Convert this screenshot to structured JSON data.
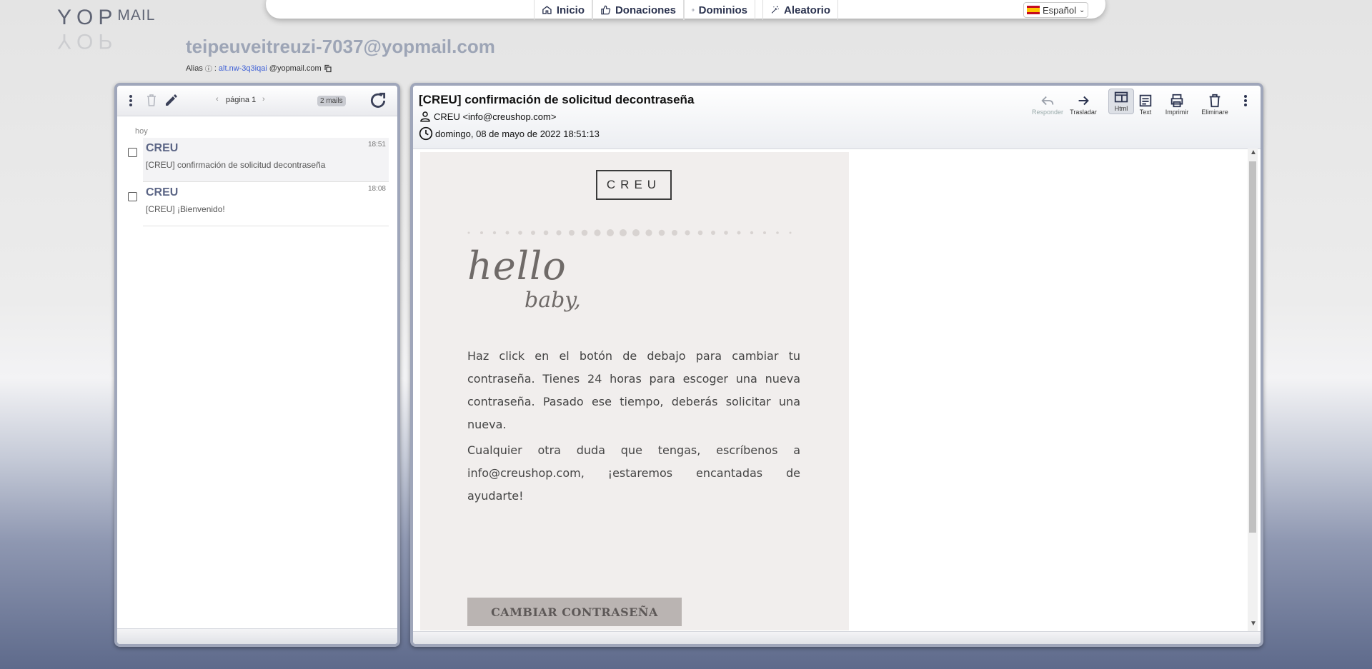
{
  "logo": {
    "text_main": "YOP",
    "text_mail": "MAIL"
  },
  "nav": {
    "items": [
      {
        "label": "Inicio",
        "icon": "home-icon"
      },
      {
        "label": "Donaciones",
        "icon": "thumbs-up-icon"
      },
      {
        "label": "Dominios",
        "icon": "globe-icon"
      },
      {
        "label": "Aleatorio",
        "icon": "magic-wand-icon"
      }
    ],
    "language": "Español"
  },
  "inbox": {
    "address": "teipeuveitreuzi-7037@yopmail.com",
    "alias_label": "Alias",
    "alias_local": "alt.nw-3q3iqai",
    "alias_domain": "@yopmail.com"
  },
  "list_toolbar": {
    "page_label": "página 1",
    "mail_count": "2 mails"
  },
  "list": {
    "day_label": "hoy",
    "mails": [
      {
        "from": "CREU",
        "subject": "[CREU] confirmación de solicitud decontraseña",
        "time": "18:51"
      },
      {
        "from": "CREU",
        "subject": "[CREU] ¡Bienvenido!",
        "time": "18:08"
      }
    ]
  },
  "message": {
    "subject": "[CREU] confirmación de solicitud decontraseña",
    "from": "CREU <info@creushop.com>",
    "date": "domingo, 08 de mayo de 2022 18:51:13",
    "toolbar": {
      "reply": "Responder",
      "forward": "Trasladar",
      "html": "Html",
      "text": "Text",
      "print": "Imprimir",
      "delete": "Eliminare"
    },
    "body": {
      "brand": "CREU",
      "hello": "hello",
      "baby": "baby,",
      "paragraph1": "Haz click en el botón de debajo para cambiar tu contraseña. Tienes 24 horas para escoger una nueva contraseña. Pasado ese tiempo, deberás solicitar una nueva.",
      "paragraph2": "Cualquier otra duda que tengas, escríbenos a info@creushop.com, ¡estaremos encantadas de ayudarte!",
      "button": "CAMBIAR CONTRASEÑA"
    }
  },
  "colors": {
    "accent_nav": "#2c3450",
    "address_text": "#9da5b6",
    "alias_link": "#3d5fd6",
    "email_bg": "#f1eeed",
    "cta_bg": "#bab4b2"
  }
}
